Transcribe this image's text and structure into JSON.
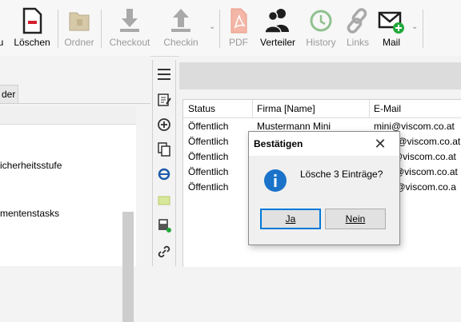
{
  "toolbar": {
    "items": [
      {
        "label": "u",
        "enabled": true,
        "icon": "doc-cut-icon"
      },
      {
        "label": "Löschen",
        "enabled": true,
        "icon": "delete-doc-icon"
      },
      {
        "label": "Ordner",
        "enabled": false,
        "icon": "folder-icon"
      },
      {
        "label": "Checkout",
        "enabled": false,
        "icon": "download-icon"
      },
      {
        "label": "Checkin",
        "enabled": false,
        "icon": "upload-icon"
      },
      {
        "label": "PDF",
        "enabled": false,
        "icon": "pdf-icon"
      },
      {
        "label": "Verteiler",
        "enabled": true,
        "icon": "people-icon"
      },
      {
        "label": "History",
        "enabled": false,
        "icon": "history-icon"
      },
      {
        "label": "Links",
        "enabled": false,
        "icon": "link-icon"
      },
      {
        "label": "Mail",
        "enabled": true,
        "icon": "mail-add-icon"
      }
    ]
  },
  "left_pane": {
    "tab_label": "der",
    "tree_items": [
      "icherheitsstufe",
      "mentenstasks"
    ]
  },
  "grid": {
    "columns": [
      "Status",
      "Firma [Name]",
      "E-Mail"
    ],
    "rows": [
      {
        "status": "Öffentlich",
        "firma": "Mustermann Mini",
        "email": "mini@viscom.co.at"
      },
      {
        "status": "Öffentlich",
        "firma": "",
        "email": "nn@viscom.co.at"
      },
      {
        "status": "Öffentlich",
        "firma": "",
        "email": "@viscom.co.at"
      },
      {
        "status": "Öffentlich",
        "firma": "",
        "email": "v@viscom.co.at"
      },
      {
        "status": "Öffentlich",
        "firma": "",
        "email": "ia@viscom.co.a"
      }
    ]
  },
  "dialog": {
    "title": "Bestätigen",
    "message": "Lösche 3 Einträge?",
    "buttons": {
      "yes": "Ja",
      "no": "Nein"
    },
    "icon": "info-icon"
  },
  "colors": {
    "accent": "#0078d7",
    "delete_red": "#d4202c",
    "mail_green": "#22a83a"
  }
}
